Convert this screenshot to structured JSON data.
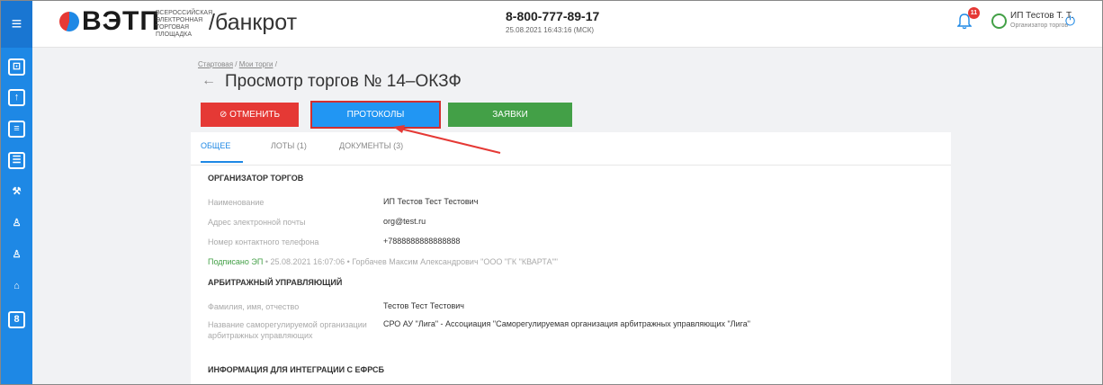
{
  "sidebar": {
    "menu_icon": "≡",
    "icons": [
      "dashboard-icon",
      "document-icon",
      "scroll-icon",
      "list-icon",
      "gavel-icon",
      "person-icon",
      "person-group-icon",
      "building-icon",
      "contacts-icon"
    ]
  },
  "header": {
    "logo_main": "ВЭТП",
    "logo_sub": "ВСЕРОССИЙСКАЯ ЭЛЕКТРОННАЯ ТОРГОВАЯ ПЛОЩАДКА",
    "logo_section": "/банкрот",
    "phone": "8-800-777-89-17",
    "datetime": "25.08.2021 16:43:16 (МСК)",
    "notifications_count": "11",
    "user_name": "ИП Тестов Т. Т.",
    "user_role": "Организатор торгов"
  },
  "breadcrumb": {
    "home": "Стартовая",
    "my": "Мои торги",
    "sep": "/"
  },
  "page": {
    "title": "Просмотр торгов № 14–ОКЗФ"
  },
  "actions": {
    "cancel": "⊘ ОТМЕНИТЬ",
    "protocols": "ПРОТОКОЛЫ",
    "bids": "ЗАЯВКИ"
  },
  "tabs": {
    "general": "ОБЩЕЕ",
    "lots": "ЛОТЫ (1)",
    "documents": "ДОКУМЕНТЫ (3)"
  },
  "organizer": {
    "title": "ОРГАНИЗАТОР ТОРГОВ",
    "name_label": "Наименование",
    "name": "ИП Тестов Тест Тестович",
    "email_label": "Адрес электронной почты",
    "email": "org@test.ru",
    "phone_label": "Номер контактного телефона",
    "phone": "+7888888888888888",
    "signature_tag": "Подписано ЭП",
    "signature_text": " • 25.08.2021 16:07:06 • Горбачев Максим Александрович \"ООО \"ГК \"КВАРТА\"\""
  },
  "manager": {
    "title": "АРБИТРАЖНЫЙ УПРАВЛЯЮЩИЙ",
    "fio_label": "Фамилия, имя, отчество",
    "fio": "Тестов Тест Тестович",
    "sro_label": "Название саморегулируемой организации арбитражных управляющих",
    "sro": "СРО АУ \"Лига\" - Ассоциация \"Саморегулируемая организация арбитражных управляющих \"Лига\""
  },
  "efrsb": {
    "title": "ИНФОРМАЦИЯ ДЛЯ ИНТЕГРАЦИИ С ЕФРСБ"
  },
  "colors": {
    "sidebar": "#1e88e5",
    "cancel": "#e53935",
    "protocols": "#2196f3",
    "bids": "#43a047",
    "highlight": "#d32f2f"
  }
}
